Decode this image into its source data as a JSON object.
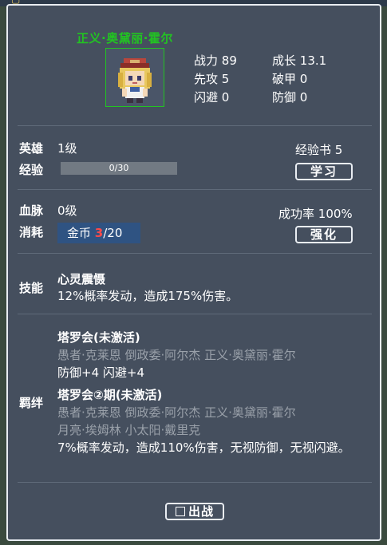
{
  "hero": {
    "name": "正义·奥黛丽·霍尔",
    "stats": [
      {
        "label": "战力",
        "value": "89"
      },
      {
        "label": "成长",
        "value": "13.1"
      },
      {
        "label": "先攻",
        "value": "5"
      },
      {
        "label": "破甲",
        "value": "0"
      },
      {
        "label": "闪避",
        "value": "0"
      },
      {
        "label": "防御",
        "value": "0"
      }
    ]
  },
  "level": {
    "hero_label": "英雄",
    "hero_level": "1级",
    "exp_label": "经验",
    "exp_text": "0/30",
    "exp_progress": 0.0,
    "book_label": "经验书",
    "book_count": "5",
    "learn_button": "学习"
  },
  "bloodline": {
    "label": "血脉",
    "level": "0级",
    "cost_label": "消耗",
    "cost_prefix": "金币",
    "cost_current": "3",
    "cost_total": "/20",
    "success_label": "成功率",
    "success_rate": "100%",
    "upgrade_button": "强化"
  },
  "skill": {
    "label": "技能",
    "name": "心灵震慑",
    "desc": "12%概率发动，造成175%伤害。"
  },
  "bonds": {
    "label": "羁绊",
    "items": [
      {
        "title": "塔罗会(未激活)",
        "members": [
          "愚者·克莱恩  倒政委·阿尔杰  正义·奥黛丽·霍尔"
        ],
        "effect": "防御+4 闪避+4"
      },
      {
        "title": "塔罗会②期(未激活)",
        "members": [
          "愚者·克莱恩  倒政委·阿尔杰  正义·奥黛丽·霍尔",
          "月亮·埃姆林  小太阳·戴里克"
        ],
        "effect": "7%概率发动，造成110%伤害，无视防御，无视闪避。"
      }
    ]
  },
  "deploy_button": "出战",
  "colors": {
    "panel_bg": "#454f5e",
    "name_green": "#22c322",
    "cost_bg": "#2f5382",
    "cost_red": "#ff4a4a",
    "muted": "#9aa1aa"
  }
}
